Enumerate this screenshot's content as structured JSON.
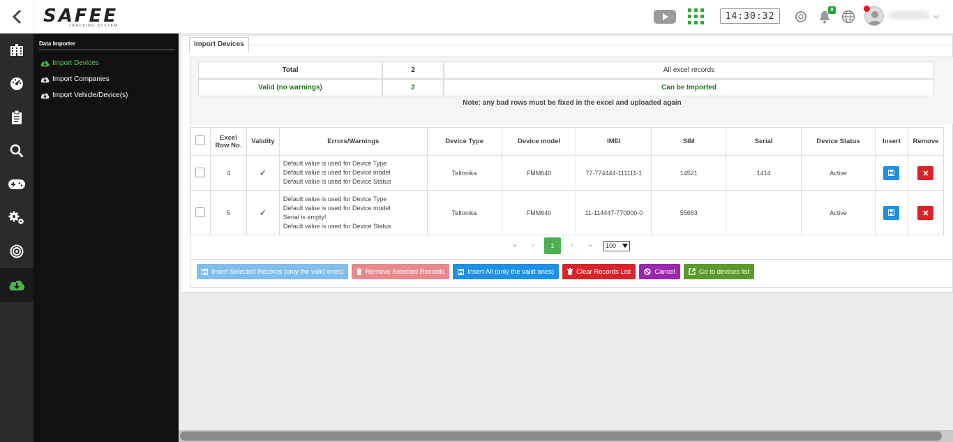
{
  "header": {
    "logo_text": "SAFEE",
    "logo_subtitle": "TRACKING SYSTEM",
    "clock": "14:30:32",
    "notification_count": "0",
    "username": ""
  },
  "rail": {
    "items": [
      "building-icon",
      "dashboard-icon",
      "clipboard-icon",
      "search-icon",
      "gamepad-icon",
      "gears-icon",
      "target-icon",
      "cloud-download-icon"
    ],
    "active_index": 7
  },
  "sidemenu": {
    "title": "Data Importer",
    "items": [
      {
        "label": "Import Devices",
        "active": true
      },
      {
        "label": "Import Companies",
        "active": false
      },
      {
        "label": "Import Vehicle/Device(s)",
        "active": false
      }
    ]
  },
  "panel": {
    "tab_label": "Import Devices",
    "summary": {
      "total_label": "Total",
      "total_count": "2",
      "total_desc": "All excel records",
      "valid_label": "Valid (no warnings)",
      "valid_count": "2",
      "valid_desc": "Can be Imported"
    },
    "note": "Note: any bad rows must be fixed in the excel and uploaded again"
  },
  "table": {
    "headers": {
      "row_no_1": "Excel",
      "row_no_2": "Row No.",
      "validity": "Validity",
      "errors": "Errors/Warnings",
      "device_type": "Device Type",
      "device_model": "Device model",
      "imei": "IMEI",
      "sim": "SIM",
      "serial": "Serial",
      "device_status": "Device Status",
      "insert": "Insert",
      "remove": "Remove"
    },
    "rows": [
      {
        "row_no": "4",
        "validity": "✓",
        "errors": [
          "Default value is used for Device Type",
          "Default value is used for Device model",
          "Default value is used for Device Status"
        ],
        "device_type": "Teltonika",
        "device_model": "FMM640",
        "imei": "77-774444-111111-1",
        "sim": "14521",
        "serial": "1414",
        "device_status": "Active"
      },
      {
        "row_no": "5",
        "validity": "✓",
        "errors": [
          "Default value is used for Device Type",
          "Default value is used for Device model",
          "Serial is empty!",
          "Default value is used for Device Status"
        ],
        "device_type": "Teltonika",
        "device_model": "FMM640",
        "imei": "11-114447-770000-0",
        "sim": "55663",
        "serial": "",
        "device_status": "Active"
      }
    ]
  },
  "pager": {
    "first": "«",
    "prev": "‹",
    "current": "1",
    "next": "›",
    "last": "»",
    "page_size": "100"
  },
  "actions": {
    "insert_selected": "Insert Selected Records (only the valid ones)",
    "remove_selected": "Remove Selected Records",
    "insert_all": "Insert All (only the valid ones)",
    "clear_list": "Clear Records List",
    "cancel": "Cancel",
    "go_devices": "Go to devices list"
  },
  "colors": {
    "accent_green": "#4caf50",
    "blue": "#1e90e6",
    "red": "#d9232a",
    "purple": "#9c27b0",
    "olive_green": "#5a9a2a"
  }
}
